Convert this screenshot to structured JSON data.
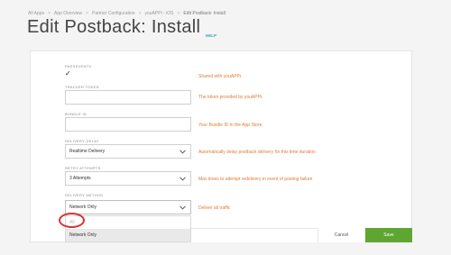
{
  "breadcrumb": {
    "items": [
      "All Apps",
      "App Overview",
      "Partner Configuration",
      "youAPPi - iOS",
      "Edit Postback: Install"
    ],
    "separator": ">"
  },
  "page": {
    "title": "Edit Postback: Install",
    "help_link": "HELP"
  },
  "form": {
    "fields": {
      "pass_events": {
        "label": "PASSEVENTS",
        "checked": true,
        "check_glyph": "✓",
        "hint": "Shared with youAPPi."
      },
      "tracker_token": {
        "label": "TRACKER TOKEN",
        "value": "",
        "hint": "The token provided by youAPPi."
      },
      "bundle_id": {
        "label": "BUNDLE ID",
        "value": "",
        "hint": "Your Bundle ID in the App Store."
      },
      "delivery_delay": {
        "label": "DELIVERY DELAY",
        "value": "Realtime Delivery",
        "hint": "Automatically delay postback delivery for this time duration"
      },
      "retry_attempts": {
        "label": "RETRY ATTEMPTS",
        "value": "3 Attempts",
        "hint": "Max times to attempt redelivery in event of posting failure"
      },
      "delivery_method": {
        "label": "DELIVERY METHOD",
        "value": "Network Only",
        "hint": "Deliver all traffic"
      }
    },
    "delivery_method_dropdown": {
      "options": [
        "All",
        "Network Only"
      ],
      "highlighted": "Network Only"
    }
  },
  "actions": {
    "cancel_label": "Cancel",
    "save_label": "Save"
  },
  "colors": {
    "accent_orange": "#e07c38",
    "help_teal": "#3aa0b4",
    "save_green": "#5ea631",
    "annotation_red": "#d83232"
  },
  "icons": {
    "select_arrow": "chevron-down-icon",
    "annotation": "red-circle-highlight"
  }
}
